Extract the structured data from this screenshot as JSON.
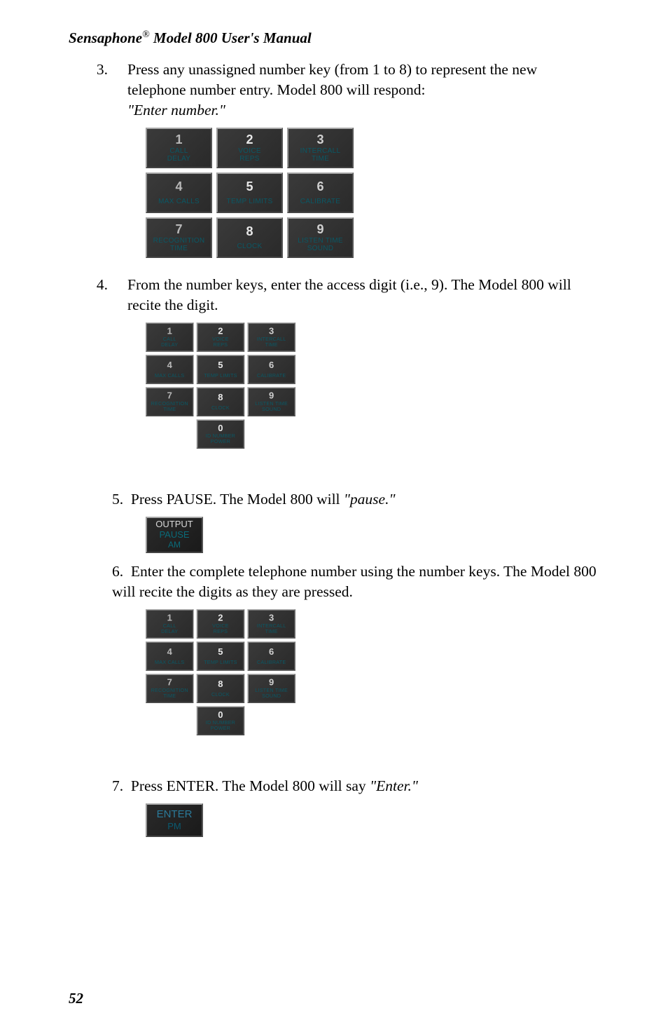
{
  "header": {
    "brand": "Sensaphone",
    "model": "Model 800 User's Manual"
  },
  "steps": {
    "s3": {
      "num": "3.",
      "p1": "Press any unassigned number key (from 1 to 8) to represent the new telephone number entry. Model 800 will respond:",
      "quote": "\"Enter number.\""
    },
    "s4": {
      "num": "4.",
      "p1": "From the number keys, enter the access digit (i.e., 9). The Model 800 will recite the digit."
    },
    "s5": {
      "num": "5.",
      "t1": "Press PAUSE. The Model 800 will ",
      "quote": "\"pause.\""
    },
    "s6": {
      "num": "6.",
      "t1": "Enter the complete telephone number using the number keys. The Model 800 will recite the digits as they are pressed."
    },
    "s7": {
      "num": "7.",
      "t1": "Press ENTER. The Model 800 will say ",
      "quote": "\"Enter.\""
    }
  },
  "keys": {
    "k1": {
      "num": "1",
      "label1": "CALL",
      "label2": "DELAY"
    },
    "k2": {
      "num": "2",
      "label1": "VOICE",
      "label2": "REPS"
    },
    "k3": {
      "num": "3",
      "label1": "INTERCALL",
      "label2": "TIME"
    },
    "k4": {
      "num": "4",
      "label1": "MAX CALLS",
      "label2": ""
    },
    "k5": {
      "num": "5",
      "label1": "TEMP LIMITS",
      "label2": ""
    },
    "k6": {
      "num": "6",
      "label1": "CALIBRATE",
      "label2": ""
    },
    "k7": {
      "num": "7",
      "label1": "RECOGNITION",
      "label2": "TIME"
    },
    "k8": {
      "num": "8",
      "label1": "CLOCK",
      "label2": ""
    },
    "k9": {
      "num": "9",
      "label1": "LISTEN TIME",
      "label2": "SOUND"
    },
    "k0": {
      "num": "0",
      "label1": "ID NUMBER",
      "label2": "POWER"
    }
  },
  "pauseKey": {
    "l1": "OUTPUT",
    "l2": "PAUSE",
    "l3": "AM"
  },
  "enterKey": {
    "l1": "ENTER",
    "l2": "PM"
  },
  "pageNum": "52"
}
